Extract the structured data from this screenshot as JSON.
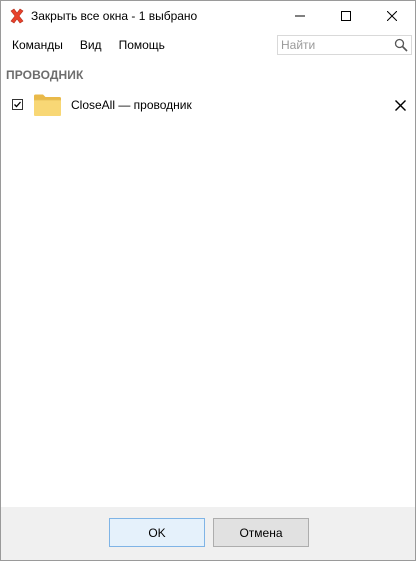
{
  "window": {
    "title": "Закрыть все окна - 1 выбрано",
    "icon": "red-x-icon"
  },
  "menu": {
    "items": [
      "Команды",
      "Вид",
      "Помощь"
    ]
  },
  "search": {
    "placeholder": "Найти",
    "value": ""
  },
  "group": {
    "header": "ПРОВОДНИК",
    "items": [
      {
        "label": "CloseAll — проводник",
        "checked": true,
        "icon": "folder-icon"
      }
    ]
  },
  "buttons": {
    "ok": "OK",
    "cancel": "Отмена"
  },
  "colors": {
    "accent_red": "#e8422c",
    "folder_yellow": "#f8d775",
    "footer_bg": "#f0f0f0",
    "header_gray": "#6d6d6d"
  }
}
